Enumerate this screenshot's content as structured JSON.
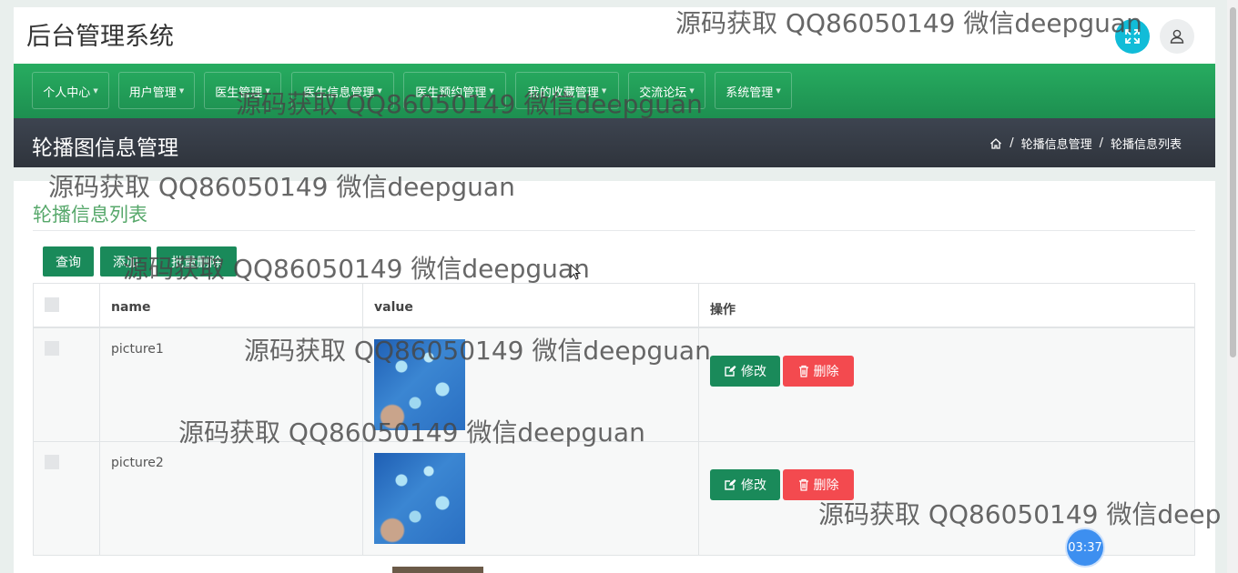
{
  "header": {
    "app_title": "后台管理系统",
    "fullscreen_icon": "expand-icon",
    "user_icon": "user-icon"
  },
  "nav": {
    "items": [
      {
        "label": "个人中心"
      },
      {
        "label": "用户管理"
      },
      {
        "label": "医生管理"
      },
      {
        "label": "医生信息管理"
      },
      {
        "label": "医生预约管理"
      },
      {
        "label": "我的收藏管理"
      },
      {
        "label": "交流论坛"
      },
      {
        "label": "系统管理"
      }
    ]
  },
  "page_header": {
    "title": "轮播图信息管理",
    "breadcrumb": [
      "轮播信息管理",
      "轮播信息列表"
    ],
    "separator": "/"
  },
  "card": {
    "title": "轮播信息列表",
    "buttons": {
      "search": "查询",
      "add": "添加",
      "batch_delete": "批量删除"
    }
  },
  "table": {
    "columns": [
      "name",
      "value",
      "操作"
    ],
    "rows": [
      {
        "name": "picture1"
      },
      {
        "name": "picture2"
      }
    ],
    "edit_label": "修改",
    "delete_label": "删除"
  },
  "watermark": "源码获取 QQ86050149 微信deepguan",
  "watermark_cut": "源码获取 QQ86050149 微信deep",
  "timer": "03:37",
  "colors": {
    "nav_green": "#27ac60",
    "button_green": "#1a8a5a",
    "danger_red": "#f34a4f",
    "header_dark": "#363b44",
    "accent_cyan": "#11bcd8",
    "title_green": "#57a86b"
  }
}
